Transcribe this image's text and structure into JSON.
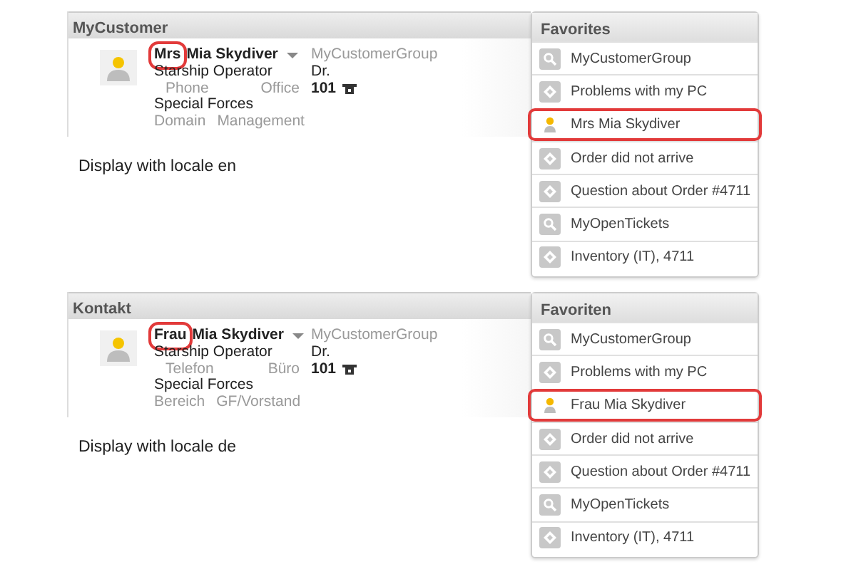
{
  "sections": [
    {
      "contact_panel": {
        "title": "MyCustomer",
        "salutation": "Mrs",
        "salutation_highlighted": true,
        "name": "Mia Skydiver",
        "group": "MyCustomerGroup",
        "position": "Starship Operator",
        "academic_title": "Dr.",
        "phone_label": "Phone",
        "office_label": "Office",
        "office_value": "101",
        "department": "Special Forces",
        "domain_label": "Domain",
        "domain_value": "Management"
      },
      "caption": "Display with locale en",
      "favorites": {
        "title": "Favorites",
        "items": [
          {
            "kind": "search",
            "label": "MyCustomerGroup",
            "highlighted": false
          },
          {
            "kind": "ticket",
            "label": "Problems with my PC",
            "highlighted": false
          },
          {
            "kind": "person",
            "label": "Mrs Mia Skydiver",
            "highlighted": true
          },
          {
            "kind": "ticket",
            "label": "Order did not arrive",
            "highlighted": false
          },
          {
            "kind": "ticket",
            "label": "Question about Order #4711",
            "highlighted": false
          },
          {
            "kind": "search",
            "label": "MyOpenTickets",
            "highlighted": false
          },
          {
            "kind": "ticket",
            "label": "Inventory (IT), 4711",
            "highlighted": false
          }
        ]
      }
    },
    {
      "contact_panel": {
        "title": "Kontakt",
        "salutation": "Frau",
        "salutation_highlighted": true,
        "name": "Mia Skydiver",
        "group": "MyCustomerGroup",
        "position": "Starship Operator",
        "academic_title": "Dr.",
        "phone_label": "Telefon",
        "office_label": "Büro",
        "office_value": "101",
        "department": "Special Forces",
        "domain_label": "Bereich",
        "domain_value": "GF/Vorstand"
      },
      "caption": "Display with locale de",
      "favorites": {
        "title": "Favoriten",
        "items": [
          {
            "kind": "search",
            "label": "MyCustomerGroup",
            "highlighted": false
          },
          {
            "kind": "ticket",
            "label": "Problems with my PC",
            "highlighted": false
          },
          {
            "kind": "person",
            "label": "Frau Mia Skydiver",
            "highlighted": true
          },
          {
            "kind": "ticket",
            "label": "Order did not arrive",
            "highlighted": false
          },
          {
            "kind": "ticket",
            "label": "Question about Order #4711",
            "highlighted": false
          },
          {
            "kind": "search",
            "label": "MyOpenTickets",
            "highlighted": false
          },
          {
            "kind": "ticket",
            "label": "Inventory (IT), 4711",
            "highlighted": false
          }
        ]
      }
    }
  ]
}
